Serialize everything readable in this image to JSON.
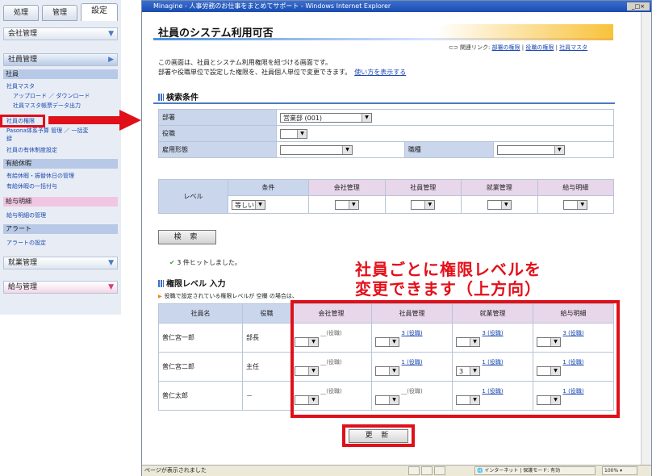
{
  "left": {
    "tabs": [
      "処理",
      "管理",
      "設定"
    ],
    "company_mgmt": "会社管理",
    "employee_mgmt": "社員管理",
    "groups": [
      {
        "header": "社員",
        "links": [
          "社員マスタ",
          "アップロード ／ ダウンロード",
          "社員マスタ帳票データ出力",
          "社員の権限",
          "Pasona体系予算 管理 ／ 一括変",
          "録",
          "社員の有休制度設定"
        ]
      },
      {
        "header": "有給休暇",
        "links": [
          "有給休暇・振替休日の管理",
          "有給休暇の一括付与"
        ]
      },
      {
        "header": "給与明細",
        "links": [
          "給与明細の管理"
        ]
      },
      {
        "header": "アラート",
        "links": [
          "アラートの設定"
        ]
      }
    ],
    "work_mgmt": "就業管理",
    "salary_mgmt": "給与管理"
  },
  "window": {
    "title": "Minagine - 人事労務のお仕事をまとめてサポート - Windows Internet Explorer",
    "controls": "_□×",
    "status": "ページが表示されました",
    "zone": "インターネット | 保護モード: 有効",
    "zoom": "100%"
  },
  "page": {
    "title": "社員のシステム利用可否",
    "related_label": "関連リンク:",
    "related_links": [
      "部署の権限",
      "役職の権限",
      "社員マスタ"
    ],
    "desc1": "この画面は、社員とシステム利用権限を紐づける画面です。",
    "desc2": "部署や役職単位で設定した権限を、社員個人単位で変更できます。",
    "howto": "使い方を表示する",
    "search_heading": "検索条件",
    "dept_label": "部署",
    "dept_value": "営業部 (001)",
    "post_label": "役職",
    "employment_label": "雇用形態",
    "job_label": "職種",
    "level_label": "レベル",
    "cond_label": "条件",
    "cond_value": "等しい",
    "cols": [
      "会社管理",
      "社員管理",
      "就業管理",
      "給与明細"
    ],
    "search_button": "検 索",
    "hit": "3 件ヒットしました。",
    "level_heading": "権限レベル 入力",
    "note": "役職で設定されている権限レベルが 空欄 の場合は、",
    "annotation1": "社員ごとに権限レベルを",
    "annotation2": "変更できます（上方向）",
    "emp_col": "社員名",
    "post_col": "役職",
    "rows": [
      {
        "name": "普仁宮一郎",
        "post": "部長",
        "vals": [
          "__(役職)",
          "3 (役職)",
          "3 (役職)",
          "3 (役職)"
        ],
        "sel": [
          "",
          "",
          "",
          ""
        ]
      },
      {
        "name": "普仁宮二郎",
        "post": "主任",
        "vals": [
          "__(役職)",
          "1 (役職)",
          "1 (役職)",
          "1 (役職)"
        ],
        "sel": [
          "",
          "",
          "3",
          ""
        ]
      },
      {
        "name": "普仁太郎",
        "post": "－",
        "vals": [
          "__(役職)",
          "__(役職)",
          "1 (役職)",
          "1 (役職)"
        ],
        "sel": [
          "",
          "",
          "",
          ""
        ]
      }
    ],
    "update_button": "更 新"
  }
}
